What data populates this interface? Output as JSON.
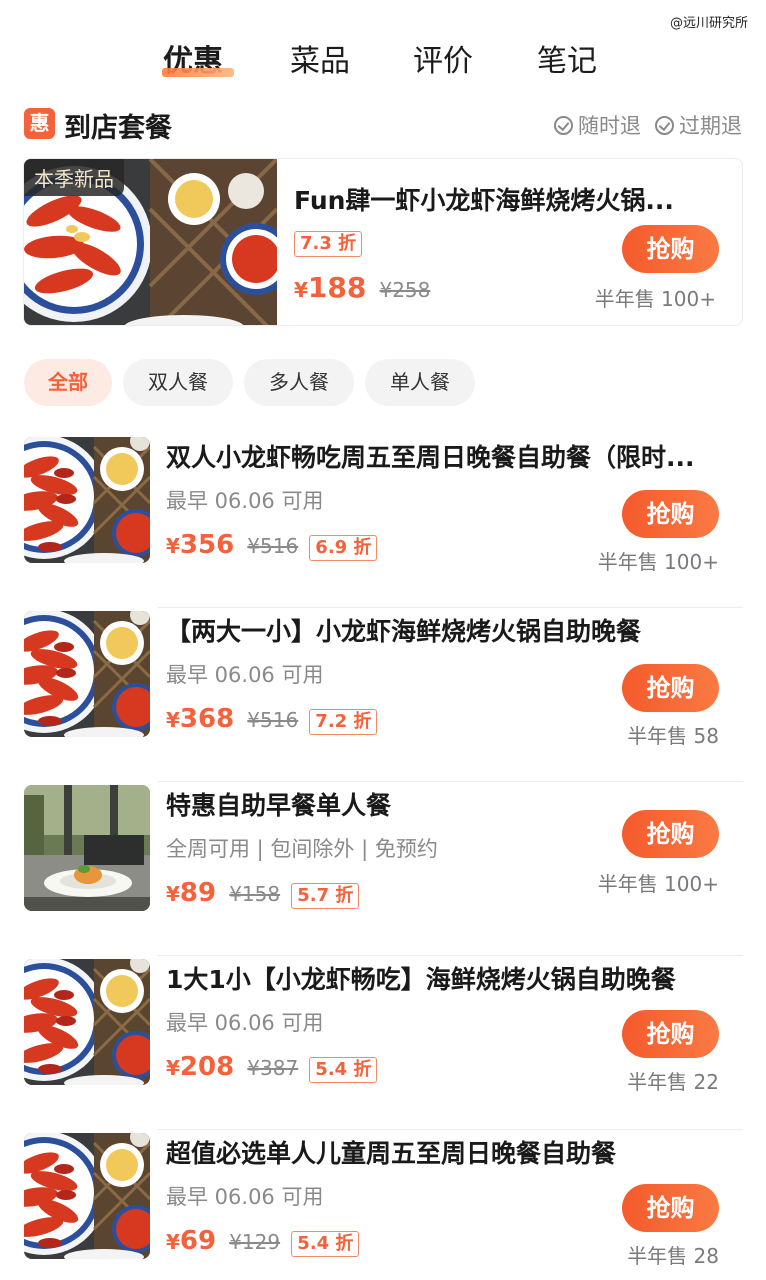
{
  "watermark": "@远川研究所",
  "tabs": [
    {
      "label": "优惠",
      "active": true
    },
    {
      "label": "菜品",
      "active": false
    },
    {
      "label": "评价",
      "active": false
    },
    {
      "label": "笔记",
      "active": false
    }
  ],
  "section": {
    "badge": "惠",
    "title": "到店套餐",
    "refund1": "随时退",
    "refund2": "过期退"
  },
  "featured": {
    "tag": "本季新品",
    "title": "Fun肆一虾小龙虾海鲜烧烤火锅...",
    "discount": "7.3 折",
    "price_symbol": "¥",
    "price": "188",
    "original": "¥258",
    "button": "抢购",
    "sold": "半年售 100+"
  },
  "filters": [
    "全部",
    "双人餐",
    "多人餐",
    "单人餐"
  ],
  "items": [
    {
      "title": "双人小龙虾畅吃周五至周日晚餐自助餐（限时...",
      "sub": "最早 06.06 可用",
      "price": "356",
      "original": "¥516",
      "discount": "6.9 折",
      "button": "抢购",
      "sold": "半年售 100+",
      "image": "crayfish"
    },
    {
      "title": "【两大一小】小龙虾海鲜烧烤火锅自助晚餐",
      "sub": "最早 06.06 可用",
      "price": "368",
      "original": "¥516",
      "discount": "7.2 折",
      "button": "抢购",
      "sold": "半年售 58",
      "image": "crayfish"
    },
    {
      "title": "特惠自助早餐单人餐",
      "sub": "全周可用 | 包间除外 | 免预约",
      "price": "89",
      "original": "¥158",
      "discount": "5.7 折",
      "button": "抢购",
      "sold": "半年售 100+",
      "image": "breakfast"
    },
    {
      "title": "1大1小【小龙虾畅吃】海鲜烧烤火锅自助晚餐",
      "sub": "最早 06.06 可用",
      "price": "208",
      "original": "¥387",
      "discount": "5.4 折",
      "button": "抢购",
      "sold": "半年售 22",
      "image": "crayfish"
    },
    {
      "title": "超值必选单人儿童周五至周日晚餐自助餐",
      "sub": "最早 06.06 可用",
      "price": "69",
      "original": "¥129",
      "discount": "5.4 折",
      "button": "抢购",
      "sold": "半年售 28",
      "image": "crayfish"
    }
  ],
  "price_symbol": "¥",
  "colors": {
    "accent": "#f4613a",
    "chip_active_bg": "#fdebe3",
    "muted": "#8a8a8a"
  }
}
